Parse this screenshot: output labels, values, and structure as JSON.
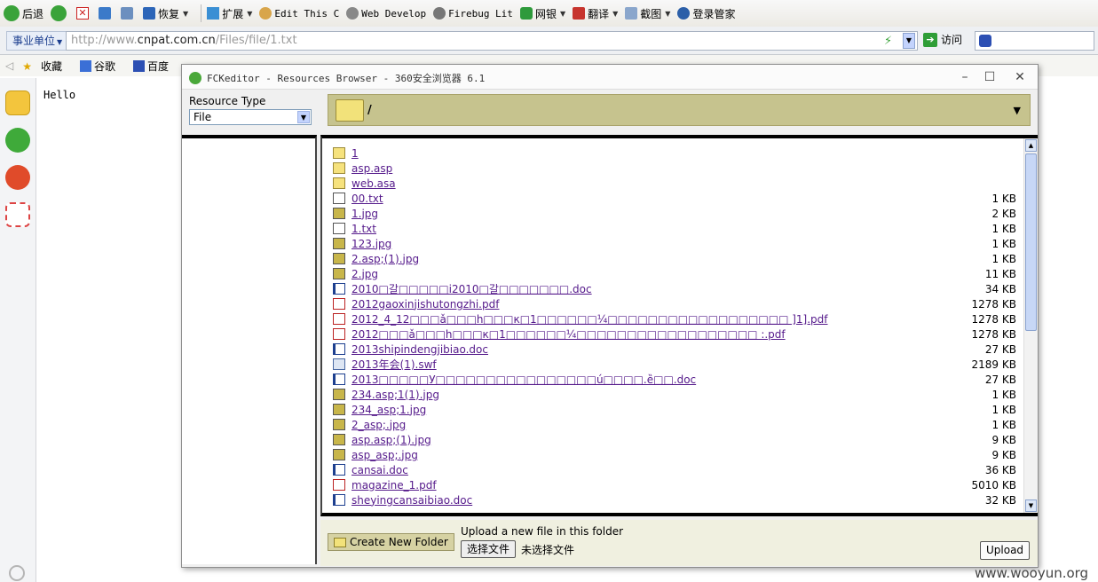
{
  "toolbar": {
    "back": "后退",
    "restore": "恢复",
    "extend": "扩展",
    "edit_this": "Edit This C",
    "web_develop": "Web Develop",
    "firebug": "Firebug Lit",
    "wangyin": "网银",
    "translate": "翻译",
    "screenshot": "截图",
    "login_mgr": "登录管家"
  },
  "address": {
    "zone": "事业单位",
    "url_prefix": "http://www.",
    "url_domain": "cnpat.com.cn",
    "url_path": "/Files/file/1.txt",
    "visit": "访问"
  },
  "bookmarks": [
    "收藏",
    "谷歌",
    "百度"
  ],
  "page": {
    "text": "Hello"
  },
  "dialog": {
    "title": "FCKeditor - Resources Browser - 360安全浏览器 6.1",
    "minimize": "–",
    "maximize": "☐",
    "close": "✕",
    "resource_type_label": "Resource Type",
    "resource_type_value": "File",
    "current_path": "/",
    "files": [
      {
        "name": "1",
        "type": "folder",
        "size": ""
      },
      {
        "name": "asp.asp",
        "type": "folder",
        "size": ""
      },
      {
        "name": "web.asa",
        "type": "folder",
        "size": ""
      },
      {
        "name": "00.txt",
        "type": "txt",
        "size": "1 KB"
      },
      {
        "name": "1.jpg",
        "type": "img",
        "size": "2 KB"
      },
      {
        "name": "1.txt",
        "type": "txt",
        "size": "1 KB"
      },
      {
        "name": "123.jpg",
        "type": "img",
        "size": "1 KB"
      },
      {
        "name": "2.asp;(1).jpg",
        "type": "img",
        "size": "1 KB"
      },
      {
        "name": "2.jpg",
        "type": "img",
        "size": "11 KB"
      },
      {
        "name": "2010□갈□□□□□i2010□갈□□□□□□□.doc",
        "type": "doc",
        "size": "34 KB"
      },
      {
        "name": "2012gaoxinjishutongzhi.pdf",
        "type": "pdf",
        "size": "1278 KB"
      },
      {
        "name": "2012_4_12□□□ǎ□□□h□□□к□1□□□□□□¼□□□□□□□□□□□□□□□□□□   ]1].pdf",
        "type": "pdf",
        "size": "1278 KB"
      },
      {
        "name": "2012□□□ǎ□□□h□□□к□1□□□□□□¼□□□□□□□□□□□□□□□□□□   :.pdf",
        "type": "pdf",
        "size": "1278 KB"
      },
      {
        "name": "2013shipindengjibiao.doc",
        "type": "doc",
        "size": "27 KB"
      },
      {
        "name": "2013年会(1).swf",
        "type": "swf",
        "size": "2189 KB"
      },
      {
        "name": "2013□□□□□У□□□□□□□□□□□□□□□□ú□□□□.ȅ□□.doc",
        "type": "doc",
        "size": "27 KB"
      },
      {
        "name": "234.asp;1(1).jpg",
        "type": "img",
        "size": "1 KB"
      },
      {
        "name": "234_asp;1.jpg",
        "type": "img",
        "size": "1 KB"
      },
      {
        "name": "2_asp;.jpg",
        "type": "img",
        "size": "1 KB"
      },
      {
        "name": "asp.asp;(1).jpg",
        "type": "img",
        "size": "9 KB"
      },
      {
        "name": "asp_asp;.jpg",
        "type": "img",
        "size": "9 KB"
      },
      {
        "name": "cansai.doc",
        "type": "doc",
        "size": "36 KB"
      },
      {
        "name": "magazine_1.pdf",
        "type": "pdf",
        "size": "5010 KB"
      },
      {
        "name": "sheyingcansaibiao.doc",
        "type": "doc",
        "size": "32 KB"
      }
    ],
    "new_folder": "Create New Folder",
    "upload_label": "Upload a new file in this folder",
    "choose_file": "选择文件",
    "no_file": "未选择文件",
    "upload": "Upload"
  },
  "watermark": "www.wooyun.org",
  "colors": {
    "folder_header": "#c6c38e",
    "link": "#551a8b",
    "footer_bg": "#f0f0e0"
  }
}
